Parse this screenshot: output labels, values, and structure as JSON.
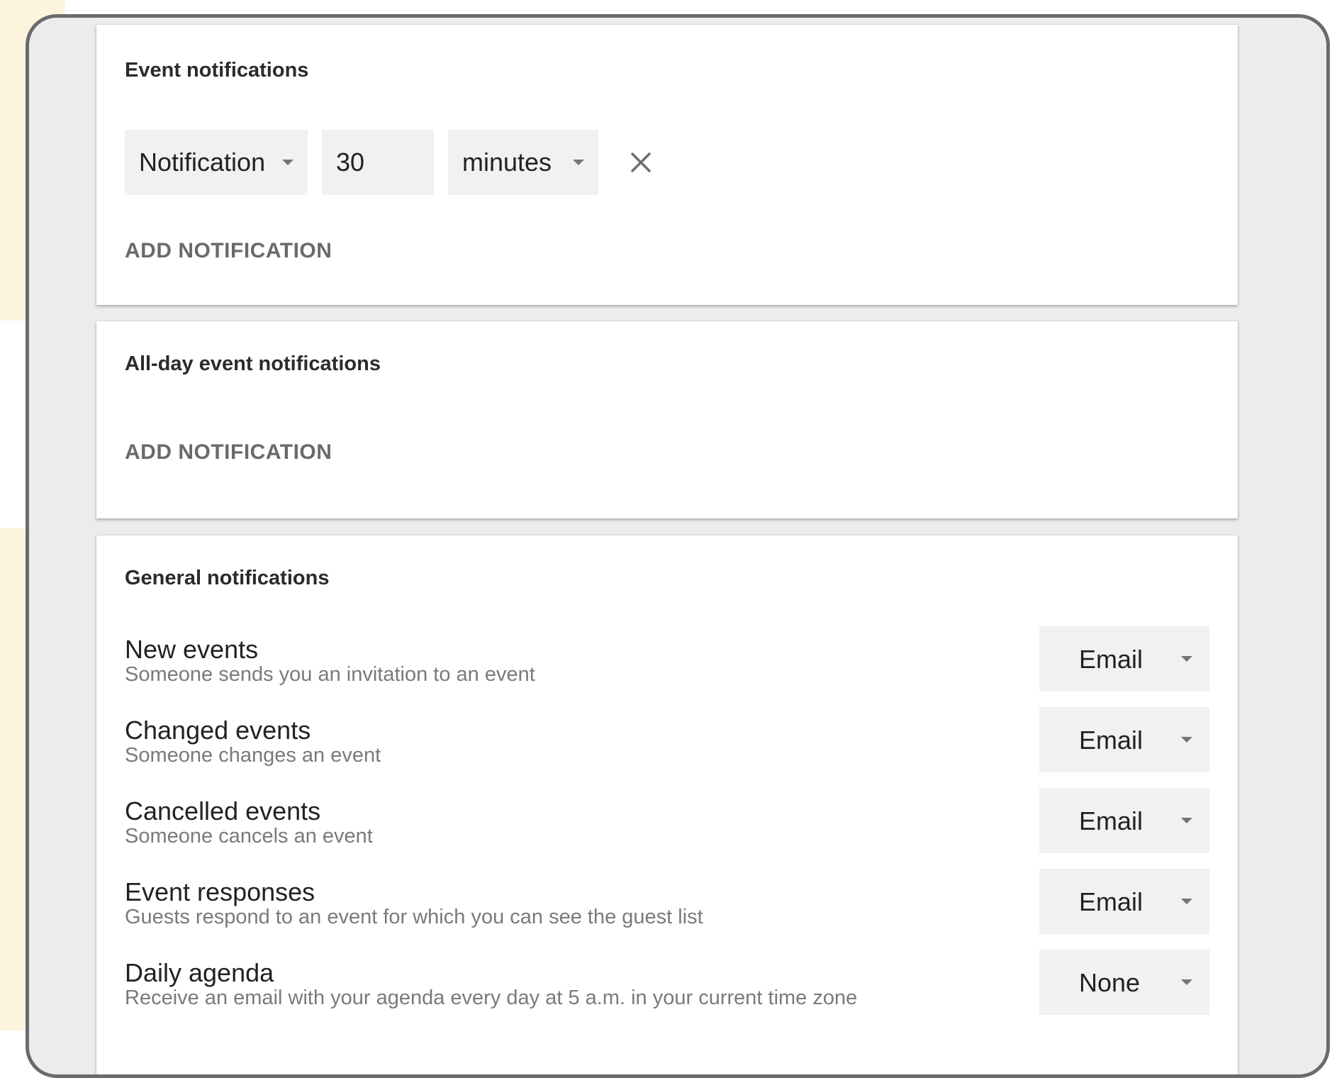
{
  "event_notifications": {
    "title": "Event notifications",
    "notification": {
      "type": "Notification",
      "amount": "30",
      "unit": "minutes"
    },
    "add_label": "ADD NOTIFICATION"
  },
  "all_day_notifications": {
    "title": "All-day event notifications",
    "add_label": "ADD NOTIFICATION"
  },
  "general_notifications": {
    "title": "General notifications",
    "rows": [
      {
        "label": "New events",
        "desc": "Someone sends you an invitation to an event",
        "value": "Email"
      },
      {
        "label": "Changed events",
        "desc": "Someone changes an event",
        "value": "Email"
      },
      {
        "label": "Cancelled events",
        "desc": "Someone cancels an event",
        "value": "Email"
      },
      {
        "label": "Event responses",
        "desc": "Guests respond to an event for which you can see the guest list",
        "value": "Email"
      },
      {
        "label": "Daily agenda",
        "desc": "Receive an email with your agenda every day at 5 a.m. in your current time zone",
        "value": "None"
      }
    ]
  }
}
